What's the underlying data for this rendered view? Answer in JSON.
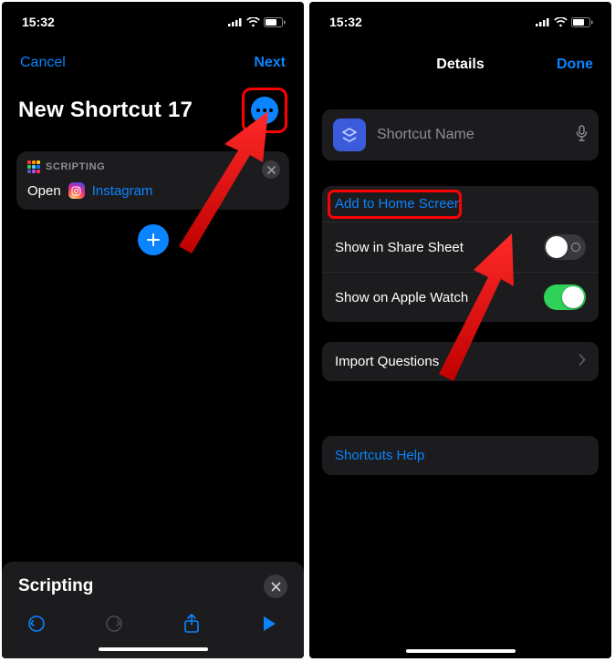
{
  "status": {
    "time": "15:32"
  },
  "left": {
    "nav": {
      "cancel": "Cancel",
      "next": "Next"
    },
    "title": "New Shortcut 17",
    "card": {
      "category": "SCRIPTING",
      "verb": "Open",
      "app": "Instagram"
    },
    "sheet": {
      "title": "Scripting"
    }
  },
  "right": {
    "nav": {
      "title": "Details",
      "done": "Done"
    },
    "namePlaceholder": "Shortcut Name",
    "rows": {
      "addHome": "Add to Home Screen",
      "shareSheet": "Show in Share Sheet",
      "appleWatch": "Show on Apple Watch",
      "importQ": "Import Questions",
      "help": "Shortcuts Help"
    }
  }
}
